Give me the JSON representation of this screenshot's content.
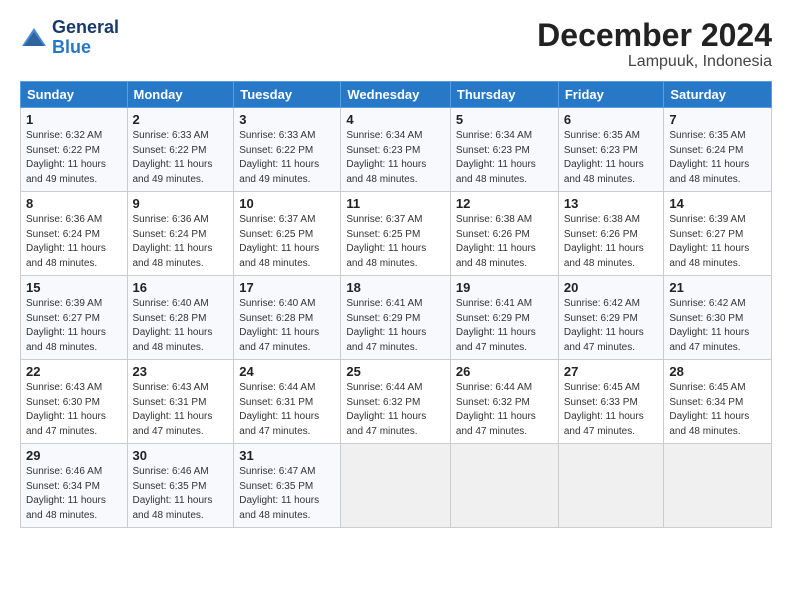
{
  "header": {
    "logo": {
      "general": "General",
      "blue": "Blue"
    },
    "title": "December 2024",
    "location": "Lampuuk, Indonesia"
  },
  "weekdays": [
    "Sunday",
    "Monday",
    "Tuesday",
    "Wednesday",
    "Thursday",
    "Friday",
    "Saturday"
  ],
  "weeks": [
    [
      {
        "day": "1",
        "sunrise": "6:32 AM",
        "sunset": "6:22 PM",
        "daylight": "11 hours and 49 minutes."
      },
      {
        "day": "2",
        "sunrise": "6:33 AM",
        "sunset": "6:22 PM",
        "daylight": "11 hours and 49 minutes."
      },
      {
        "day": "3",
        "sunrise": "6:33 AM",
        "sunset": "6:22 PM",
        "daylight": "11 hours and 49 minutes."
      },
      {
        "day": "4",
        "sunrise": "6:34 AM",
        "sunset": "6:23 PM",
        "daylight": "11 hours and 48 minutes."
      },
      {
        "day": "5",
        "sunrise": "6:34 AM",
        "sunset": "6:23 PM",
        "daylight": "11 hours and 48 minutes."
      },
      {
        "day": "6",
        "sunrise": "6:35 AM",
        "sunset": "6:23 PM",
        "daylight": "11 hours and 48 minutes."
      },
      {
        "day": "7",
        "sunrise": "6:35 AM",
        "sunset": "6:24 PM",
        "daylight": "11 hours and 48 minutes."
      }
    ],
    [
      {
        "day": "8",
        "sunrise": "6:36 AM",
        "sunset": "6:24 PM",
        "daylight": "11 hours and 48 minutes."
      },
      {
        "day": "9",
        "sunrise": "6:36 AM",
        "sunset": "6:24 PM",
        "daylight": "11 hours and 48 minutes."
      },
      {
        "day": "10",
        "sunrise": "6:37 AM",
        "sunset": "6:25 PM",
        "daylight": "11 hours and 48 minutes."
      },
      {
        "day": "11",
        "sunrise": "6:37 AM",
        "sunset": "6:25 PM",
        "daylight": "11 hours and 48 minutes."
      },
      {
        "day": "12",
        "sunrise": "6:38 AM",
        "sunset": "6:26 PM",
        "daylight": "11 hours and 48 minutes."
      },
      {
        "day": "13",
        "sunrise": "6:38 AM",
        "sunset": "6:26 PM",
        "daylight": "11 hours and 48 minutes."
      },
      {
        "day": "14",
        "sunrise": "6:39 AM",
        "sunset": "6:27 PM",
        "daylight": "11 hours and 48 minutes."
      }
    ],
    [
      {
        "day": "15",
        "sunrise": "6:39 AM",
        "sunset": "6:27 PM",
        "daylight": "11 hours and 48 minutes."
      },
      {
        "day": "16",
        "sunrise": "6:40 AM",
        "sunset": "6:28 PM",
        "daylight": "11 hours and 48 minutes."
      },
      {
        "day": "17",
        "sunrise": "6:40 AM",
        "sunset": "6:28 PM",
        "daylight": "11 hours and 47 minutes."
      },
      {
        "day": "18",
        "sunrise": "6:41 AM",
        "sunset": "6:29 PM",
        "daylight": "11 hours and 47 minutes."
      },
      {
        "day": "19",
        "sunrise": "6:41 AM",
        "sunset": "6:29 PM",
        "daylight": "11 hours and 47 minutes."
      },
      {
        "day": "20",
        "sunrise": "6:42 AM",
        "sunset": "6:29 PM",
        "daylight": "11 hours and 47 minutes."
      },
      {
        "day": "21",
        "sunrise": "6:42 AM",
        "sunset": "6:30 PM",
        "daylight": "11 hours and 47 minutes."
      }
    ],
    [
      {
        "day": "22",
        "sunrise": "6:43 AM",
        "sunset": "6:30 PM",
        "daylight": "11 hours and 47 minutes."
      },
      {
        "day": "23",
        "sunrise": "6:43 AM",
        "sunset": "6:31 PM",
        "daylight": "11 hours and 47 minutes."
      },
      {
        "day": "24",
        "sunrise": "6:44 AM",
        "sunset": "6:31 PM",
        "daylight": "11 hours and 47 minutes."
      },
      {
        "day": "25",
        "sunrise": "6:44 AM",
        "sunset": "6:32 PM",
        "daylight": "11 hours and 47 minutes."
      },
      {
        "day": "26",
        "sunrise": "6:44 AM",
        "sunset": "6:32 PM",
        "daylight": "11 hours and 47 minutes."
      },
      {
        "day": "27",
        "sunrise": "6:45 AM",
        "sunset": "6:33 PM",
        "daylight": "11 hours and 47 minutes."
      },
      {
        "day": "28",
        "sunrise": "6:45 AM",
        "sunset": "6:34 PM",
        "daylight": "11 hours and 48 minutes."
      }
    ],
    [
      {
        "day": "29",
        "sunrise": "6:46 AM",
        "sunset": "6:34 PM",
        "daylight": "11 hours and 48 minutes."
      },
      {
        "day": "30",
        "sunrise": "6:46 AM",
        "sunset": "6:35 PM",
        "daylight": "11 hours and 48 minutes."
      },
      {
        "day": "31",
        "sunrise": "6:47 AM",
        "sunset": "6:35 PM",
        "daylight": "11 hours and 48 minutes."
      },
      null,
      null,
      null,
      null
    ]
  ]
}
